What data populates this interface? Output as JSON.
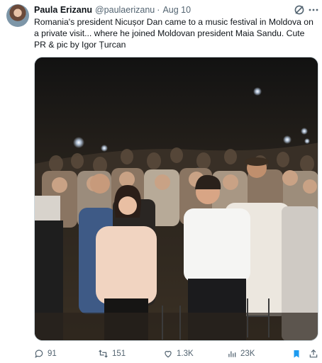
{
  "author": {
    "display_name": "Paula Erizanu",
    "handle": "@paulaerizanu",
    "separator": "·",
    "date": "Aug 10"
  },
  "tweet": {
    "text": "Romania's president Nicușor Dan came to a music festival in Moldova on a private visit... where he joined Moldovan president Maia Sandu. Cute PR & pic by Igor Țurcan"
  },
  "actions": {
    "replies": "91",
    "reposts": "151",
    "likes": "1.3K",
    "views": "23K"
  },
  "icons": {
    "reply": "reply-icon",
    "repost": "repost-icon",
    "like": "like-icon",
    "views": "views-icon",
    "bookmark": "bookmark-icon",
    "share": "share-icon",
    "grok": "grok-icon",
    "more": "more-icon"
  },
  "colors": {
    "text_primary": "#0f1419",
    "text_secondary": "#536471",
    "bookmark_active": "#1d9bf0"
  }
}
